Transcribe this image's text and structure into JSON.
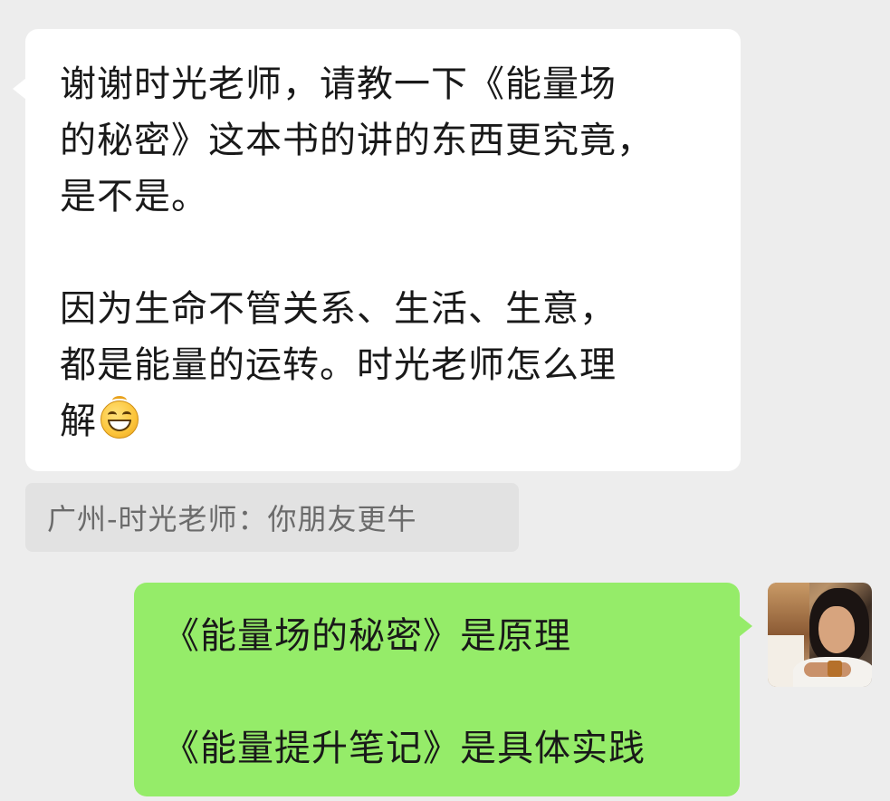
{
  "incoming_message": {
    "lines": [
      "谢谢时光老师，请教一下《能量场",
      "的秘密》这本书的讲的东西更究竟，",
      "是不是。",
      "",
      "因为生命不管关系、生活、生意，",
      "都是能量的运转。时光老师怎么理",
      "解"
    ],
    "emoji": "grinning-face"
  },
  "quoted_reply": {
    "text": "广州-时光老师：你朋友更牛"
  },
  "outgoing_message": {
    "lines": [
      "《能量场的秘密》是原理",
      "",
      "《能量提升笔记》是具体实践"
    ]
  },
  "colors": {
    "background": "#ededed",
    "incoming_bubble": "#ffffff",
    "outgoing_bubble": "#95ec69",
    "quote_bg": "#e2e2e2",
    "quote_text": "#6b6b6b"
  }
}
